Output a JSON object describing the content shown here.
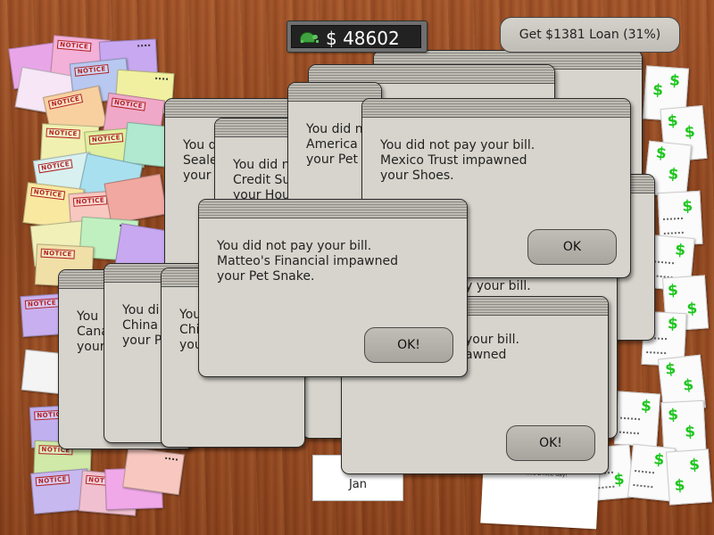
{
  "hud": {
    "money": "$ 48602",
    "loan_button": "Get $1381 Loan (31%)"
  },
  "desk": {
    "envelope_stamp": "NOTICE",
    "calendar_month": "Jan",
    "receipt_text": "Thanks, and have a nice day!",
    "bill_symbol": "$"
  },
  "dialogs": {
    "d1": {
      "message": "",
      "ok": ""
    },
    "d2": {
      "message": "",
      "ok": ""
    },
    "d3": {
      "message": "You did n\nSeale\nyour",
      "ok": ""
    },
    "d4": {
      "message": "You did n\nCredit Su\nyour Hou",
      "ok": ""
    },
    "d5": {
      "message": "You did n\nAmerica\nyour Pet",
      "ok": ""
    },
    "d6": {
      "message": "You did not pay your bill.\nMexico Trust impawned\nyour Shoes.",
      "ok": "OK"
    },
    "d7": {
      "message": "y your bill.",
      "ok": ""
    },
    "d8": {
      "message": "You\nCana\nyour",
      "ok": ""
    },
    "d9": {
      "message": "You di\nChina\nyour P",
      "ok": ""
    },
    "d10": {
      "message": "You\nChi\nyou",
      "ok": ""
    },
    "d11": {
      "message": "your bill.\nawned",
      "ok": "OK!"
    },
    "d12": {
      "message": "You did not pay your bill.\nMatteo's Financial impawned\nyour Pet Snake.",
      "ok": "OK!"
    }
  }
}
